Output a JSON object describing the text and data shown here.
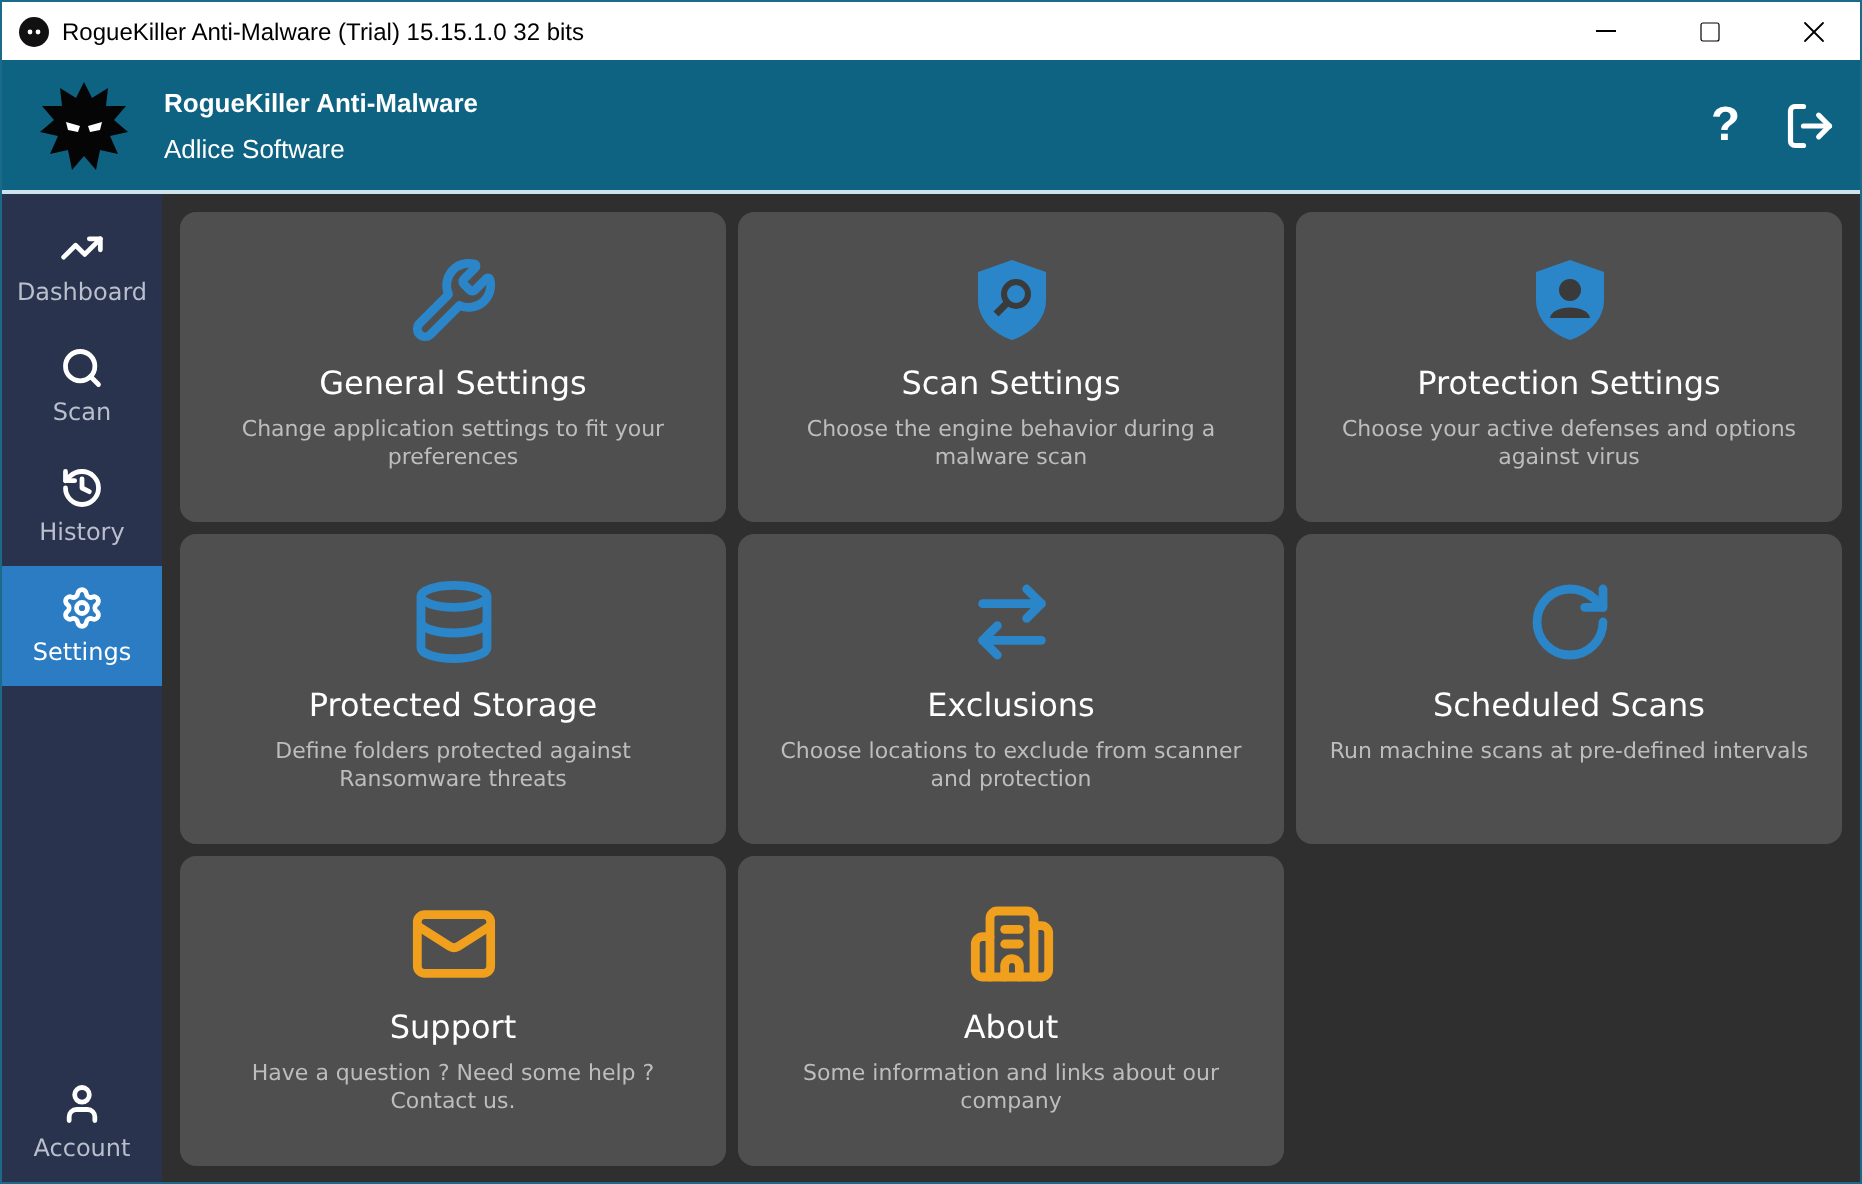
{
  "window": {
    "title": "RogueKiller Anti-Malware (Trial) 15.15.1.0 32 bits"
  },
  "header": {
    "title": "RogueKiller Anti-Malware",
    "subtitle": "Adlice Software",
    "help": "?"
  },
  "sidebar": {
    "items": [
      {
        "label": "Dashboard",
        "kind": "chart",
        "selected": false
      },
      {
        "label": "Scan",
        "kind": "search",
        "selected": false
      },
      {
        "label": "History",
        "kind": "history",
        "selected": false
      },
      {
        "label": "Settings",
        "kind": "gear",
        "selected": true
      }
    ],
    "bottom": {
      "label": "Account",
      "kind": "user",
      "selected": false
    }
  },
  "cards": [
    {
      "title": "General Settings",
      "description": "Change application settings to fit your preferences",
      "kind": "tools"
    },
    {
      "title": "Scan Settings",
      "description": "Choose the engine behavior during a malware scan",
      "kind": "shield-search"
    },
    {
      "title": "Protection Settings",
      "description": "Choose your active defenses and options against virus",
      "kind": "shield-user"
    },
    {
      "title": "Protected Storage",
      "description": "Define folders protected against Ransomware threats",
      "kind": "storage-shield"
    },
    {
      "title": "Exclusions",
      "description": "Choose locations to exclude from scanner and protection",
      "kind": "storage-arrows"
    },
    {
      "title": "Scheduled Scans",
      "description": "Run machine scans at pre-defined intervals",
      "kind": "clock"
    },
    {
      "title": "Support",
      "description": "Have a question ? Need some help ? Contact us.",
      "kind": "mail"
    },
    {
      "title": "About",
      "description": "Some information and links about our company",
      "kind": "building"
    }
  ]
}
